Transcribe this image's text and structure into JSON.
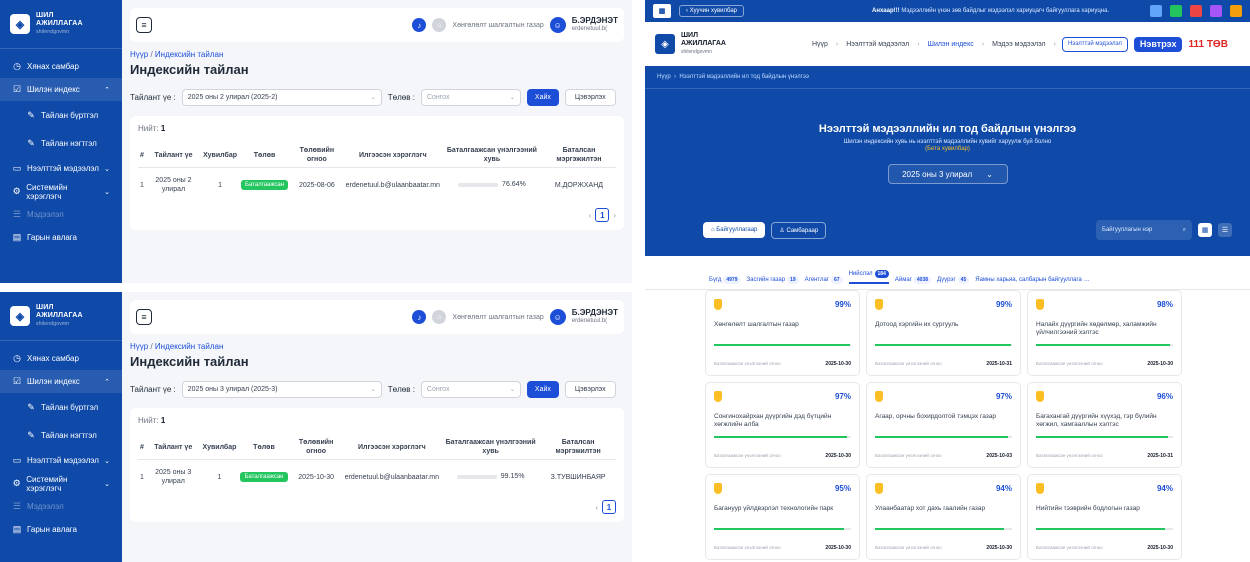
{
  "admin": {
    "brand_line1": "ШИЛ",
    "brand_line2": "АЖИЛЛАГАА",
    "brand_sub": "shilendgovmn",
    "nav": {
      "dashboard": "Хянах самбар",
      "index": "Шилэн индекс",
      "report_register": "Тайлан бүртгэл",
      "report_summary": "Тайлан нэгтгэл",
      "open_data": "Нээлттэй мэдээлэл",
      "system_user": "Системийн хэрэглэгч",
      "data": "Мэдээлэл",
      "guide": "Гарын авлага"
    },
    "org_name": "Хөнгөлөлт шалгалтын газар",
    "user_name": "Б.ЭРДЭНЭТ",
    "user_email": "erdenetuul.b(",
    "crumb_home": "Нүүр",
    "crumb_page": "Индексийн тайлан",
    "title": "Индексийн тайлан",
    "period_label": "Тайлант үе :",
    "status_label": "Төлөв :",
    "status_placeholder": "Сонгох",
    "search_btn": "Хайх",
    "clear_btn": "Цэвэрлэх",
    "total_label": "Нийт:",
    "total_value": "1",
    "headers": [
      "#",
      "Тайлант үе",
      "Хувилбар",
      "Төлөв",
      "Төлөвийн огноо",
      "Илгээсэн хэрэглэгч",
      "Баталгаажсан үнэлгээний хувь",
      "Баталсан мэргэжилтэн"
    ],
    "page": "1"
  },
  "reports": [
    {
      "period_select": "2025 оны 2 улирал (2025-2)",
      "row": {
        "n": "1",
        "period": "2025 оны 2 улирал",
        "version": "1",
        "status": "Баталгаажсан",
        "date": "2025-08-06",
        "sender": "erdenetuul.b@ulaanbaatar.mn",
        "pct_text": "76.64%",
        "pct": 76.64,
        "expert": "М.ДОРЖХАНД"
      }
    },
    {
      "period_select": "2025 оны 3 улирал (2025-3)",
      "row": {
        "n": "1",
        "period": "2025 оны 3 улирал",
        "version": "1",
        "status": "Баталгаажсан",
        "date": "2025-10-30",
        "sender": "erdenetuul.b@ulaanbaatar.mn",
        "pct_text": "99.15%",
        "pct": 99.15,
        "expert": "З.ТУВШИНБАЯР"
      }
    }
  ],
  "portal": {
    "back_label": "‹ Хуучин хувилбар",
    "announce_strong": "Анхаар!!!",
    "announce_text": "Мэдээллийн үнэн зөв байдлыг мэдээлэл хариуцагч байгууллага хариуцна.",
    "brand_line1": "ШИЛ",
    "brand_line2": "АЖИЛЛАГАА",
    "brand_sub": "shilendgovmn",
    "nav": [
      "Нүүр",
      "Нээлттэй мэдээлэл",
      "Шилэн индекс",
      "Мэдээ мэдээлэл"
    ],
    "btn_open_data": "Нээлттэй мэдээлэл",
    "btn_login": "Нэвтрэх",
    "gov_logo_text": "111 ТӨВ",
    "crumb_home": "Нүүр",
    "crumb_page": "Нээлттэй мэдээллийн ил тод байдлын үнэлгээ",
    "hero_title": "Нээлттэй мэдээллийн ил тод байдлын үнэлгээ",
    "hero_sub": "Шилэн индексийн хувь нь нээлттэй мэдээллийн хувийг харуулж буй болно",
    "hero_beta": "(Бета хувилбар)",
    "period": "2025 оны 3 улирал",
    "tab_orgs": "Байгууллагаар",
    "tab_board": "Самбараар",
    "search_placeholder": "Байгууллагын нэр",
    "categories": [
      {
        "label": "Бүгд",
        "count": "4979"
      },
      {
        "label": "Засгийн газар",
        "count": "19"
      },
      {
        "label": "Агентлаг",
        "count": "67"
      },
      {
        "label": "Нийслэл",
        "count": "184"
      },
      {
        "label": "Аймаг",
        "count": "4038"
      },
      {
        "label": "Дүүрэг",
        "count": "45"
      },
      {
        "label": "Яамны харьяа, салбарын байгууллага",
        "count": ""
      }
    ],
    "date_label": "Баталгаажсан үнэлгээний огноо",
    "orgs": [
      {
        "pct": "99%",
        "value": 99,
        "name": "Хөнгөлөлт шалгалтын газар",
        "date": "2025-10-30"
      },
      {
        "pct": "99%",
        "value": 99,
        "name": "Дотоод хэргийн их сургууль",
        "date": "2025-10-31"
      },
      {
        "pct": "98%",
        "value": 98,
        "name": "Налайх дүүргийн хөдөлмөр, халамжийн үйлчилгээний хэлтэс",
        "date": "2025-10-30"
      },
      {
        "pct": "97%",
        "value": 97,
        "name": "Сонгинохайрхан дүүргийн дэд бүтцийн хөгжлийн алба",
        "date": "2025-10-30"
      },
      {
        "pct": "97%",
        "value": 97,
        "name": "Агаар, орчны бохирдолтой тэмцэх газар",
        "date": "2025-10-03"
      },
      {
        "pct": "96%",
        "value": 96,
        "name": "Багахангай дүүргийн хүүхэд, гэр бүлийн хөгжил, хамгааллын хэлтэс",
        "date": "2025-10-31"
      },
      {
        "pct": "95%",
        "value": 95,
        "name": "Багануур үйлдвэрлэл технологийн парк",
        "date": "2025-10-30"
      },
      {
        "pct": "94%",
        "value": 94,
        "name": "Улаанбаатар хот дахь гаалийн газар",
        "date": "2025-10-30"
      },
      {
        "pct": "94%",
        "value": 94,
        "name": "Нийтийн тээврийн бодлогын газар",
        "date": "2025-10-30"
      }
    ]
  },
  "colors": {
    "primary": "#0f4aa8",
    "accent": "#1d4ed8",
    "success": "#22c55e",
    "gold": "#fbbf24"
  }
}
